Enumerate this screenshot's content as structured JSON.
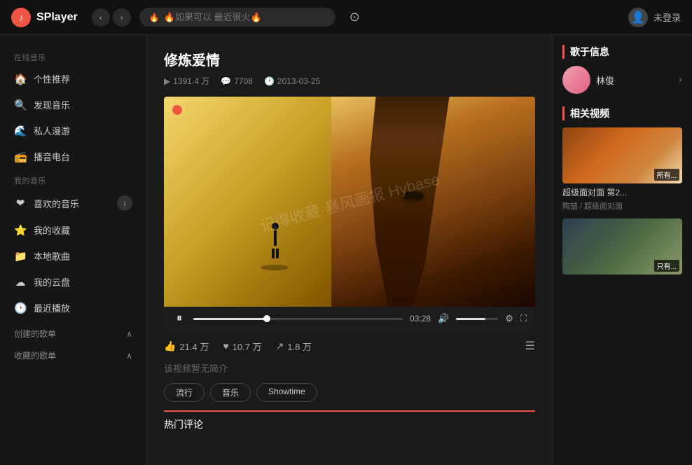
{
  "app": {
    "name": "SPlayer",
    "logo_icon": "♪"
  },
  "header": {
    "back_label": "‹",
    "forward_label": "›",
    "search_placeholder": "🔥如果可以 最近很火🔥",
    "github_icon": "github",
    "user_label": "未登录"
  },
  "sidebar": {
    "online_music_label": "在线音乐",
    "items_online": [
      {
        "icon": "🏠",
        "label": "个性推荐"
      },
      {
        "icon": "🔍",
        "label": "发现音乐"
      },
      {
        "icon": "🌊",
        "label": "私人漫游"
      },
      {
        "icon": "📻",
        "label": "播音电台"
      }
    ],
    "my_music_label": "我的音乐",
    "items_my": [
      {
        "icon": "❤",
        "label": "喜欢的音乐",
        "badge": "↓"
      },
      {
        "icon": "⭐",
        "label": "我的收藏"
      },
      {
        "icon": "📁",
        "label": "本地歌曲"
      },
      {
        "icon": "☁",
        "label": "我的云盘"
      },
      {
        "icon": "🕒",
        "label": "最近播放"
      }
    ],
    "created_playlist_label": "创建的歌单",
    "collected_playlist_label": "收藏的歌单"
  },
  "song": {
    "title": "修炼爱情",
    "play_count": "1391.4 万",
    "comment_count": "7708",
    "date": "2013-03-25",
    "play_count_icon": "▶",
    "comment_icon": "💬",
    "date_icon": "🕐"
  },
  "video_controls": {
    "play_icon": "⏸",
    "time": "03:28",
    "volume_icon": "🔊",
    "settings_icon": "⚙",
    "fullscreen_icon": "⛶",
    "progress_percent": 35,
    "volume_percent": 70
  },
  "interactions": {
    "likes": "21.4 万",
    "favorites": "10.7 万",
    "shares": "1.8 万",
    "like_icon": "👍",
    "fav_icon": "♥",
    "share_icon": "↗"
  },
  "description": {
    "text": "该视频暂无简介"
  },
  "tags": [
    {
      "label": "流行"
    },
    {
      "label": "音乐"
    },
    {
      "label": "Showtime"
    }
  ],
  "hot_comments_label": "热门评论",
  "watermark_text": "记得收藏·暴风画报\nHybase",
  "right_panel": {
    "artist_section_title": "歌于信息",
    "artist_name": "林俊",
    "related_section_title": "相关视频",
    "related_videos": [
      {
        "thumb_label": "所有...",
        "title": "超级面对面 第2...",
        "subtitle": "陶喆 / 超级面对面"
      },
      {
        "thumb_label": "只有...",
        "title": "",
        "subtitle": ""
      }
    ]
  }
}
